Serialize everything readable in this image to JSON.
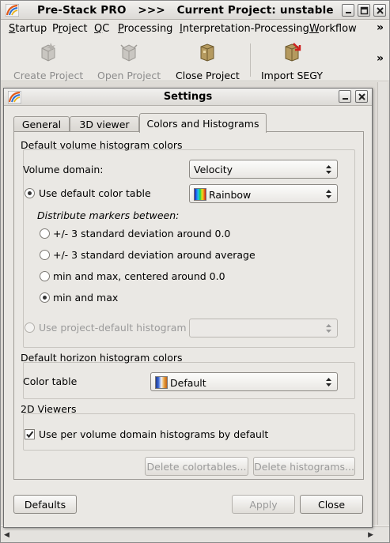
{
  "main_window": {
    "title": "Pre-Stack PRO   >>>   Current Project: unstable",
    "menu": [
      {
        "pre": "",
        "ul": "S",
        "post": "tartup"
      },
      {
        "pre": "P",
        "ul": "r",
        "post": "oject"
      },
      {
        "pre": "",
        "ul": "Q",
        "post": "C"
      },
      {
        "pre": "",
        "ul": "P",
        "post": "rocessing"
      },
      {
        "pre": "",
        "ul": "I",
        "post": "nterpretation-Processing"
      },
      {
        "pre": "",
        "ul": "W",
        "post": "orkflow"
      }
    ],
    "menu_more": "»",
    "toolbar": {
      "create_project": "Create Project",
      "open_project": "Open Project",
      "close_project": "Close Project",
      "import_segy": "Import SEGY",
      "more": "»"
    }
  },
  "settings_dialog": {
    "title": "Settings",
    "tabs": [
      "General",
      "3D viewer",
      "Colors and Histograms"
    ],
    "active_tab": "Colors and Histograms",
    "volume_group": {
      "title": "Default volume histogram colors",
      "volume_domain_label": "Volume domain:",
      "volume_domain_value": "Velocity",
      "use_default_color_table_label": "Use default color table",
      "use_default_color_table_checked": true,
      "color_table_value": "Rainbow",
      "distribute_label": "Distribute markers between:",
      "distribute_options": [
        "+/- 3 standard deviation around 0.0",
        "+/- 3 standard deviation around average",
        "min and max, centered around 0.0",
        "min and max"
      ],
      "distribute_selected": "min and max",
      "use_project_default_label": "Use project-default histogram",
      "use_project_default_value": ""
    },
    "horizon_group": {
      "title": "Default horizon histogram colors",
      "color_table_label": "Color table",
      "color_table_value": "Default"
    },
    "viewers_group": {
      "title": "2D Viewers",
      "per_domain_label": "Use per volume domain histograms by default",
      "per_domain_checked": true
    },
    "buttons": {
      "delete_colortables": "Delete colortables...",
      "delete_histograms": "Delete histograms...",
      "defaults": "Defaults",
      "apply": "Apply",
      "close": "Close"
    }
  },
  "colors": {
    "window_bg": "#eae8e4",
    "disabled_text": "#8c8c8c",
    "rainbow_gradient": [
      "#1a1aa8",
      "#1f6ff0",
      "#1fc4e8",
      "#1fd048",
      "#e8e21a",
      "#f08a1a",
      "#c81818"
    ],
    "default_gradient": [
      "#223a8a",
      "#3c6ad8",
      "#f4f4f4",
      "#e8a03c",
      "#c0601a"
    ]
  }
}
